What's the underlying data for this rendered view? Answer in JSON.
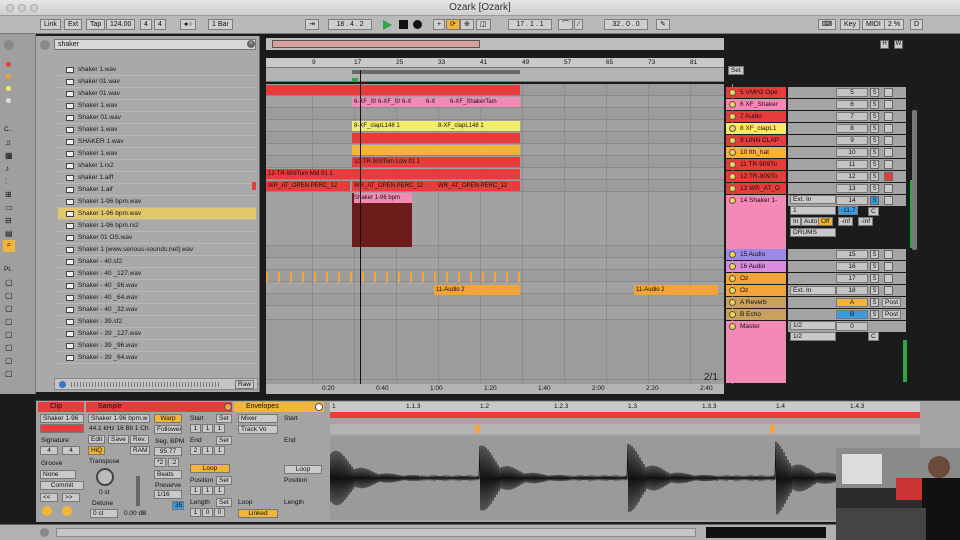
{
  "window": {
    "title": "Ozark  [Ozark]"
  },
  "control_bar": {
    "link": "Link",
    "ext": "Ext",
    "tap": "Tap",
    "tempo": "124.00",
    "sig_num": "4",
    "sig_den": "4",
    "metro": "1 Bar",
    "position": "18 .  4 .  2",
    "loop_start": "17 .  1 .  1",
    "loop_len": "32 .  0 .  0",
    "key": "Key",
    "midi": "MIDI",
    "cpu": "2 %",
    "d_label": "D"
  },
  "browser": {
    "search": "shaker",
    "places": [
      "C..",
      "Pl.."
    ],
    "files": [
      "shaker 1.wav",
      "shaker 01.wav",
      "shaker 01.wav",
      "Shaker 1.wav",
      "Shaker 01.wav",
      "Shaker 1.wav",
      "SHAKER 1.wav",
      "Shaker 1.wav",
      "shaker 1.rx2",
      "shaker 1.aiff",
      "Shaker 1.aif",
      "Shaker 1-96 bpm.wav",
      "Shaker 1-96 bpm.wav",
      "Shaker 1-96 bpm.rx2",
      "Shaker 01 OS.wav",
      "Shaker 1 [www.serious-sounds.net].wav",
      "Shaker - 40.sf2",
      "Shaker - 40 _127.wav",
      "Shaker - 40 _96.wav",
      "Shaker - 40 _64.wav",
      "Shaker - 40 _32.wav",
      "Shaker - 39.sf2",
      "Shaker - 39 _127.wav",
      "Shaker - 39 _96.wav",
      "Shaker - 39 _64.wav"
    ],
    "selected_index": 12,
    "raw": "Raw"
  },
  "arrangement": {
    "bars": [
      "9",
      "17",
      "25",
      "33",
      "41",
      "49",
      "57",
      "65",
      "73",
      "81"
    ],
    "times": [
      "0:20",
      "0:40",
      "1:00",
      "1:20",
      "1:40",
      "2:00",
      "2:20",
      "2:40"
    ],
    "page": "2/1",
    "set": "Set",
    "clips": {
      "xf_shaker": [
        "6-XF_Shal",
        "6-XF_Shal",
        "6-X",
        "6-X",
        "6-XF_ShakerTam"
      ],
      "clap": [
        "8-XF_clapL148 1",
        "8-XF_clapL148 1"
      ],
      "tom_low": "10-TR-909Tom Low 01 1",
      "tom_mid": "12-TR-909Tom Mid 01 1",
      "wr_at": [
        "WR_AT_OPEN PERC_12",
        "WR_AT_OPEN PERC_12",
        "WR_AT_OPEN PERC_12"
      ],
      "shaker_bpm": "Shaker 1-96 bpm",
      "audio2": [
        "11-Audio 2",
        "11-Audio 2"
      ]
    }
  },
  "tracks": [
    {
      "name": "5 VMH2 Ope",
      "color": "#e83b3b",
      "num": "5"
    },
    {
      "name": "6 XF_Shaker",
      "color": "#f28ab5",
      "num": "6"
    },
    {
      "name": "7 Audio",
      "color": "#e83b3b",
      "num": "7"
    },
    {
      "name": "8 XF_clapL1",
      "color": "#f3ee6a",
      "num": "8"
    },
    {
      "name": "9 LINN CLAP",
      "color": "#e83b3b",
      "num": "9"
    },
    {
      "name": "10 tth_hat",
      "color": "#f2b53a",
      "num": "10"
    },
    {
      "name": "11 TR-909To",
      "color": "#e83b3b",
      "num": "11"
    },
    {
      "name": "12 TR-909To",
      "color": "#e83b3b",
      "num": "12"
    },
    {
      "name": "13 WR_AT_O",
      "color": "#e83b3b",
      "num": "13"
    },
    {
      "name": "14 Shaker 1-",
      "color": "#f28ab5",
      "num": "14"
    },
    {
      "name": "15 Audio",
      "color": "#9c88e8",
      "num": "15"
    },
    {
      "name": "16 Audio",
      "color": "#d98be0",
      "num": "16"
    },
    {
      "name": "Oz",
      "color": "#f2a33a",
      "num": "17"
    },
    {
      "name": "Oz",
      "color": "#f2a33a",
      "num": "18"
    },
    {
      "name": "A Reverb",
      "color": "#c9a15a",
      "num": "A"
    },
    {
      "name": "B Echo",
      "color": "#c9a15a",
      "num": "B"
    },
    {
      "name": "Master",
      "color": "#f28ab5",
      "num": "0"
    }
  ],
  "mixer": {
    "ext_in": "Ext. In",
    "in": "In",
    "auto": "Auto",
    "off": "Off",
    "drums": "DRUMS",
    "vol": "-11.7",
    "inf1": "-inf",
    "inf2": "-inf",
    "half": "1/2",
    "post": "Post",
    "c": "C",
    "s": "S"
  },
  "detail": {
    "clip_title": "Clip",
    "clip_name": "Shaker 1-96",
    "signature": "Signature",
    "sig_num": "4",
    "sig_den": "4",
    "groove": "Groove",
    "groove_val": "None",
    "commit": "Commit",
    "sample_title": "Sample",
    "sample_name": "Shaker 1-96 bpm.w",
    "sample_info": "44.1 kHz 16 Bit 1 Ch",
    "edit": "Edit",
    "save": "Save",
    "rev": "Rev.",
    "hiq": "HiQ",
    "ram": "RAM",
    "warp": "Warp",
    "follower": "Follower",
    "seg_bpm": "Seg. BPM",
    "bpm": "95.77",
    "x2": "*2",
    "div2": ":2",
    "beats": "Beats",
    "preserve": "Preserve",
    "pres_val": "1/16",
    "pres_num": "35",
    "transpose": "Transpose",
    "st": "0 st",
    "detune": "Detune",
    "ct": "0 ct",
    "db": "0.00 dB",
    "start": "Start",
    "end": "End",
    "loop": "Loop",
    "position": "Position",
    "length": "Length",
    "set": "Set",
    "start_vals": [
      "1",
      "1",
      "1"
    ],
    "end_vals": [
      "2",
      "1",
      "1"
    ],
    "pos_vals": [
      "1",
      "1",
      "1"
    ],
    "len_vals": [
      "1",
      "0",
      "0"
    ],
    "env_title": "Envelopes",
    "env_mixer": "Mixer",
    "env_track": "Track Vo",
    "linked": "Linked",
    "env_start": "Start",
    "env_end": "End",
    "env_loop": "Loop",
    "env_pos": "Position",
    "env_len": "Length",
    "timeline": [
      "1",
      "1.1.3",
      "1.2",
      "1.2.3",
      "1.3",
      "1.3.3",
      "1.4",
      "1.4.3"
    ]
  }
}
